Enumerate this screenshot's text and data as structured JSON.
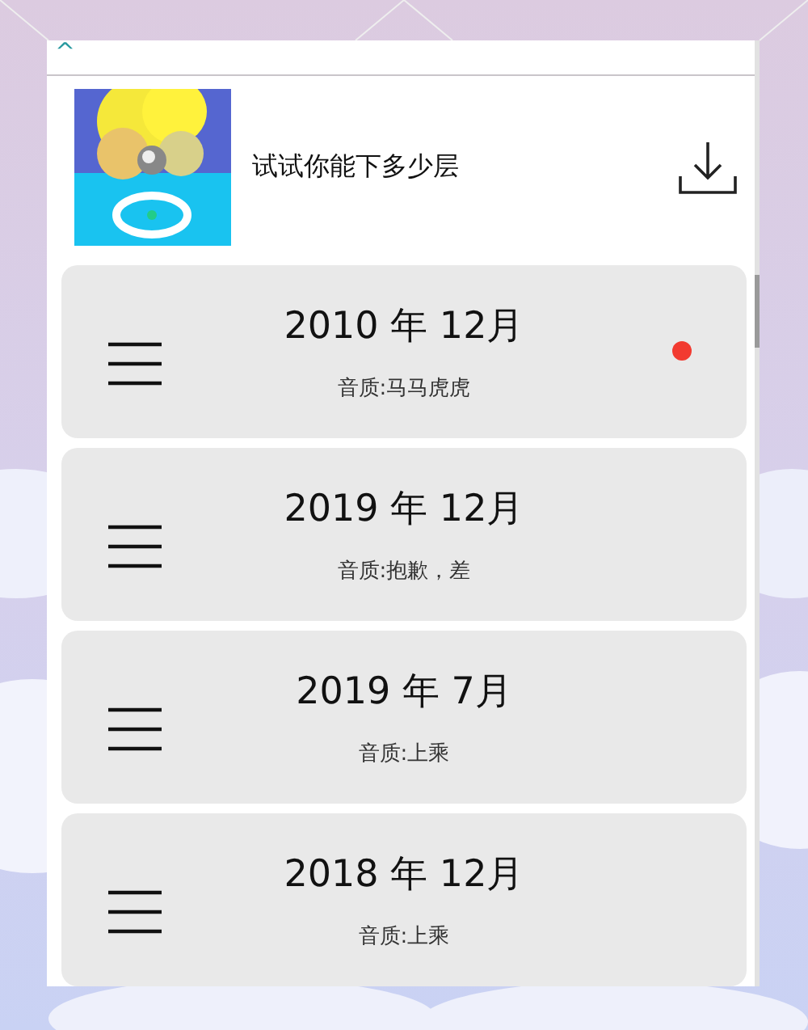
{
  "header": {
    "back_icon": "^"
  },
  "app": {
    "title": "试试你能下多少层"
  },
  "records": [
    {
      "date": "2010 年 12月",
      "quality": "音质:马马虎虎",
      "dot": true
    },
    {
      "date": "2019 年 12月",
      "quality": "音质:抱歉，差",
      "dot": false
    },
    {
      "date": "2019 年 7月",
      "quality": "音质:上乘",
      "dot": false
    },
    {
      "date": "2018 年 12月",
      "quality": "音质:上乘",
      "dot": false
    }
  ]
}
